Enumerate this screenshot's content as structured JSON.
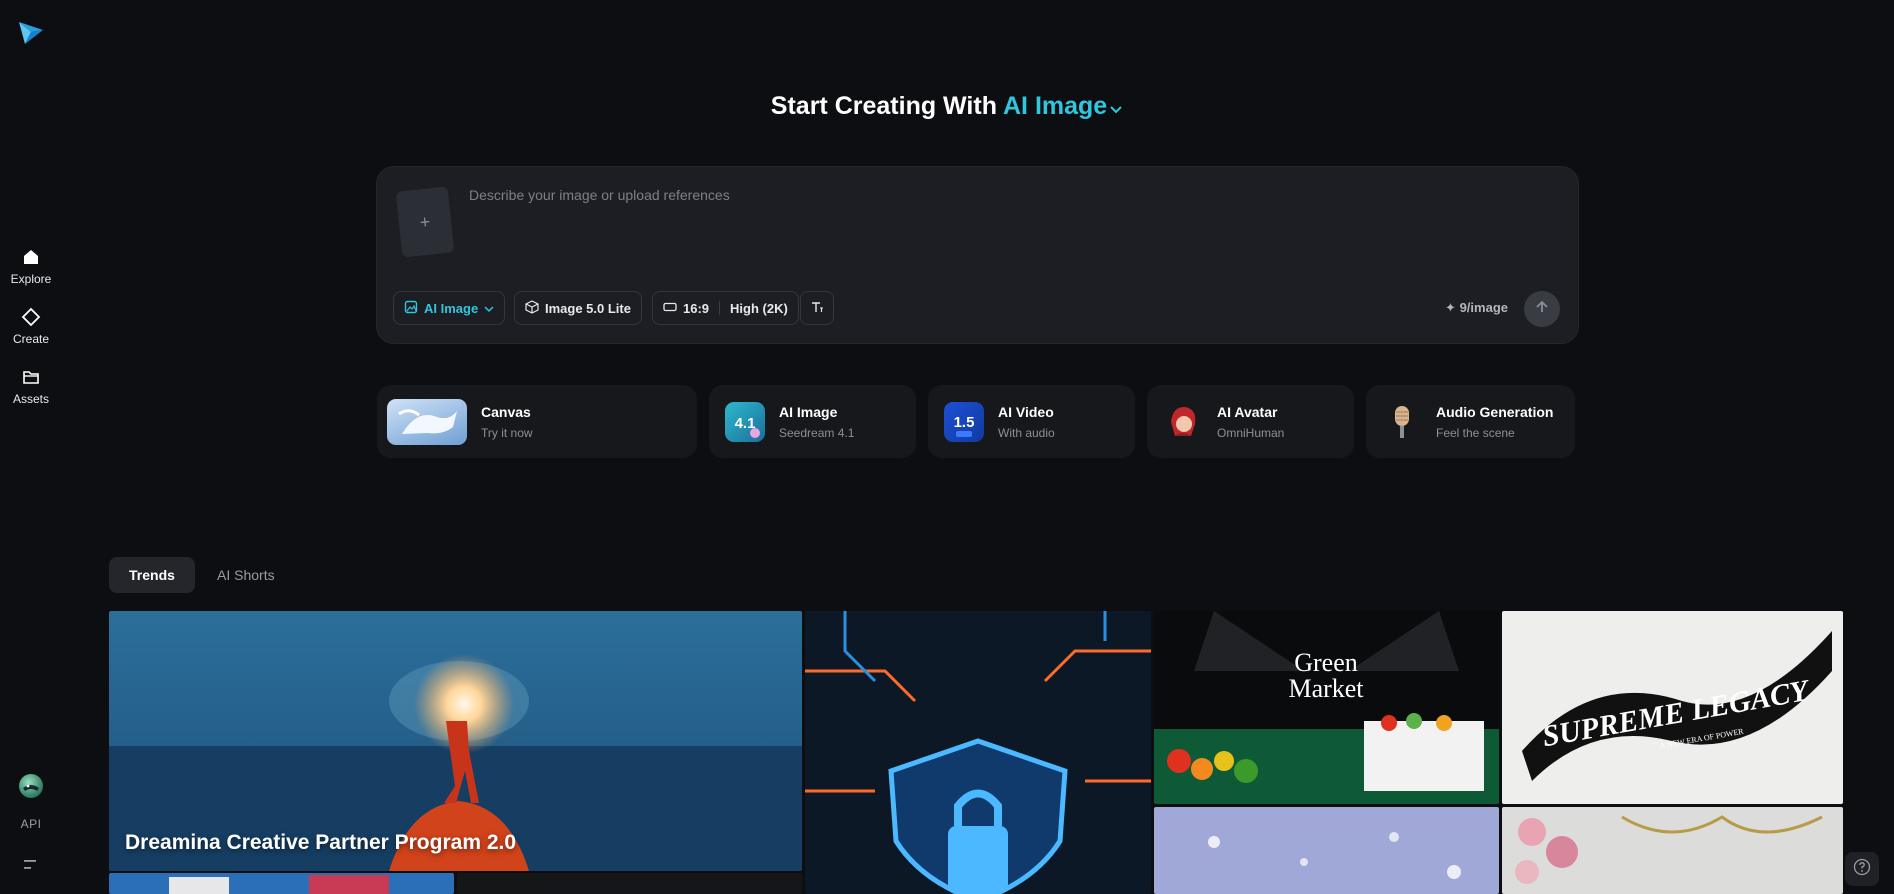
{
  "sidebar": {
    "logo": "dreamina-logo",
    "items": [
      {
        "label": "Explore",
        "icon": "home-icon"
      },
      {
        "label": "Create",
        "icon": "diamond-icon"
      },
      {
        "label": "Assets",
        "icon": "folder-icon"
      }
    ],
    "api_label": "API",
    "menu_icon": "menu-icon"
  },
  "headline": {
    "prefix": "Start Creating With",
    "mode": "AI Image"
  },
  "composer": {
    "placeholder": "Describe your image or upload references",
    "upload_symbol": "+",
    "tools": {
      "mode": "AI Image",
      "model": "Image 5.0 Lite",
      "ratio": "16:9",
      "quality": "High (2K)"
    },
    "credits": "9/image"
  },
  "features": [
    {
      "title": "Canvas",
      "subtitle": "Try it now"
    },
    {
      "title": "AI Image",
      "subtitle": "Seedream 4.1",
      "badge": "4.1"
    },
    {
      "title": "AI Video",
      "subtitle": "With audio",
      "badge": "1.5"
    },
    {
      "title": "AI Avatar",
      "subtitle": "OmniHuman"
    },
    {
      "title": "Audio Generation",
      "subtitle": "Feel the scene"
    }
  ],
  "tabs": [
    {
      "label": "Trends",
      "active": true
    },
    {
      "label": "AI Shorts",
      "active": false
    }
  ],
  "gallery": {
    "featured_caption": "Dreamina Creative Partner Program 2.0",
    "tiles": [
      {
        "kind": "featured"
      },
      {
        "kind": "security-lock"
      },
      {
        "kind": "green-market",
        "text_line1": "Green",
        "text_line2": "Market"
      },
      {
        "kind": "supreme-legacy",
        "title": "SUPREME LEGACY",
        "tagline": "A NEW ERA OF POWER"
      },
      {
        "kind": "snow"
      },
      {
        "kind": "roses"
      }
    ]
  },
  "colors": {
    "accent": "#2fc6de",
    "background": "#0d0e11",
    "panel": "#1d1e23"
  }
}
